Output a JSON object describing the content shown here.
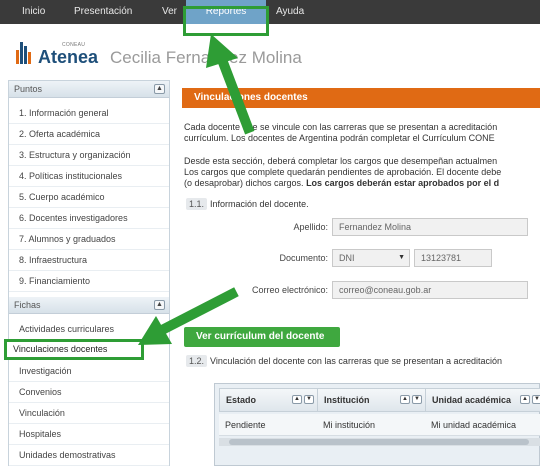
{
  "nav": {
    "items": [
      "Inicio",
      "Presentación",
      "Ver",
      "Reportes",
      "Ayuda"
    ],
    "active": "Reportes"
  },
  "header": {
    "brand_small": "CONEAU",
    "brand": "Atenea",
    "user_name": "Cecilia Fernandez Molina"
  },
  "sidebar": {
    "puntos_title": "Puntos",
    "puntos": [
      "1. Información general",
      "2. Oferta académica",
      "3. Estructura y organización",
      "4. Políticas institucionales",
      "5. Cuerpo académico",
      "6. Docentes investigadores",
      "7. Alumnos y graduados",
      "8. Infraestructura",
      "9. Financiamiento"
    ],
    "fichas_title": "Fichas",
    "fichas": [
      "Actividades curriculares",
      "Vinculaciones docentes",
      "Investigación",
      "Convenios",
      "Vinculación",
      "Hospitales",
      "Unidades demostrativas"
    ],
    "toggle_symbol": "▲"
  },
  "main": {
    "title": "Vinculaciones docentes",
    "intro_line1": "Cada docente que se vincule con las carreras que se presentan a acreditación",
    "intro_line2": "currículum. Los docentes de Argentina podrán completar el Currículum CONE",
    "desc_line1": "Desde esta sección, deberá completar los cargos que desempeñan actualmen",
    "desc_line2": "Los cargos que complete quedarán pendientes de aprobación. El docente debe",
    "desc_line3_normal": "(o desaprobar) dichos cargos. ",
    "desc_line3_bold": "Los cargos deberán estar aprobados por el d",
    "section1_num": "1.1.",
    "section1_title": "Información del docente.",
    "apellido_label": "Apellido:",
    "apellido_value": "Fernandez Molina",
    "documento_label": "Documento:",
    "documento_type": "DNI",
    "documento_number": "13123781",
    "correo_label": "Correo electrónico:",
    "correo_value": "correo@coneau.gob.ar",
    "cv_button": "Ver currículum del docente",
    "section2_num": "1.2.",
    "section2_title": "Vinculación del docente con las carreras que se presentan a acreditación",
    "table": {
      "headers": [
        "Estado",
        "Institución",
        "Unidad académica"
      ],
      "sort_symbols": [
        "▲",
        "▼"
      ],
      "rows": [
        [
          "Pendiente",
          "Mi institución",
          "Mi unidad académica"
        ]
      ]
    }
  },
  "colors": {
    "nav_bg": "#3a3a3a",
    "nav_active": "#6fa3c8",
    "orange_header": "#e06a14",
    "green_button": "#3fa83f",
    "callout_green": "#2e9d35",
    "brand_blue": "#1e4f7a"
  }
}
